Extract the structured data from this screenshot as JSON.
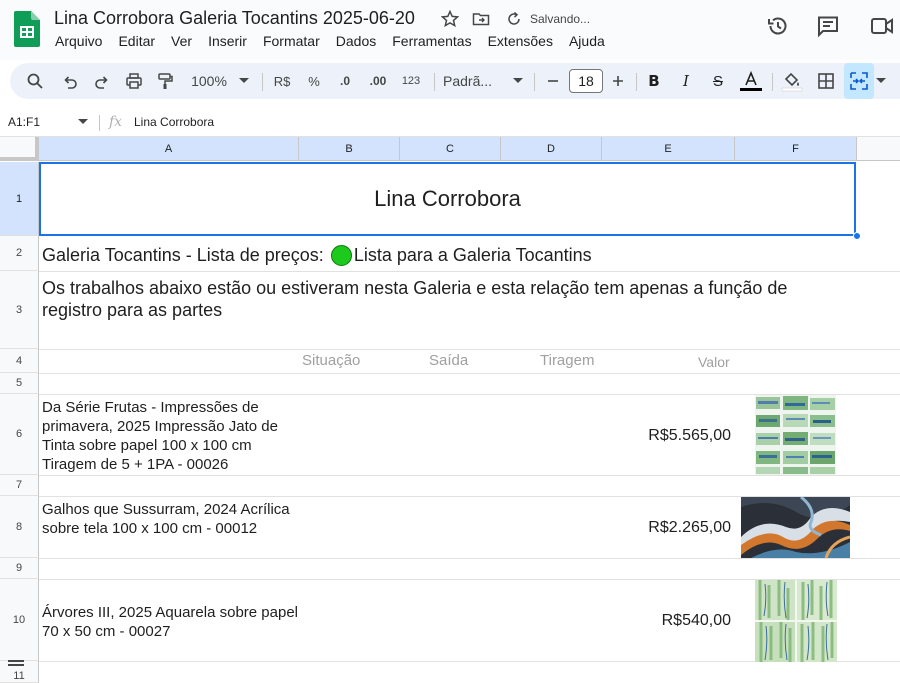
{
  "doc": {
    "title": "Lina Corrobora Galeria Tocantins 2025-06-20",
    "saving_status": "Salvando..."
  },
  "menu": [
    "Arquivo",
    "Editar",
    "Ver",
    "Inserir",
    "Formatar",
    "Dados",
    "Ferramentas",
    "Extensões",
    "Ajuda"
  ],
  "toolbar": {
    "zoom": "100%",
    "currency": "R$",
    "percent": "%",
    "dec_decrease": ".0",
    "dec_increase": ".00",
    "number_format": "123",
    "font": "Padrã...",
    "font_size": "18"
  },
  "formula_bar": {
    "name_box": "A1:F1",
    "fx": "fx",
    "content": "Lina Corrobora"
  },
  "columns": [
    "A",
    "B",
    "C",
    "D",
    "E",
    "F"
  ],
  "rows": [
    "1",
    "2",
    "3",
    "4",
    "5",
    "6",
    "7",
    "8",
    "9",
    "10",
    "11"
  ],
  "sheet": {
    "title": "Lina Corrobora",
    "row2_prefix": "Galeria Tocantins - Lista de preços: ",
    "row2_link": "Lista para a Galeria Tocantins",
    "row3_text": "Os trabalhos abaixo estão ou estiveram nesta Galeria e esta relação tem apenas a função de registro para as partes",
    "headers": {
      "situacao": "Situação",
      "saida": "Saída",
      "tiragem": "Tiragem",
      "valor": "Valor"
    },
    "items": [
      {
        "description": "Da Série Frutas - Impressões de primavera, 2025 Impressão Jato de Tinta sobre papel 100 x 100 cm Tiragem de 5 + 1PA - 00026",
        "valor": "R$5.565,00",
        "image": "green-blue-brushstroke-grid-thumbnail"
      },
      {
        "description": "Galhos que Sussurram, 2024 Acrílica sobre tela 100 x 100 cm - 00012",
        "valor": "R$2.265,00",
        "image": "dark-orange-blue-swirl-thumbnail"
      },
      {
        "description": "Árvores III, 2025 Aquarela sobre papel 70 x 50 cm - 00027",
        "valor": "R$540,00",
        "image": "green-watercolor-grid-thumbnail"
      }
    ]
  },
  "colors": {
    "accent": "#1a73e8",
    "status_dot": "#1ec91e",
    "header_selected": "#d3e3fd",
    "toolbar_bg": "#edf2fa"
  }
}
